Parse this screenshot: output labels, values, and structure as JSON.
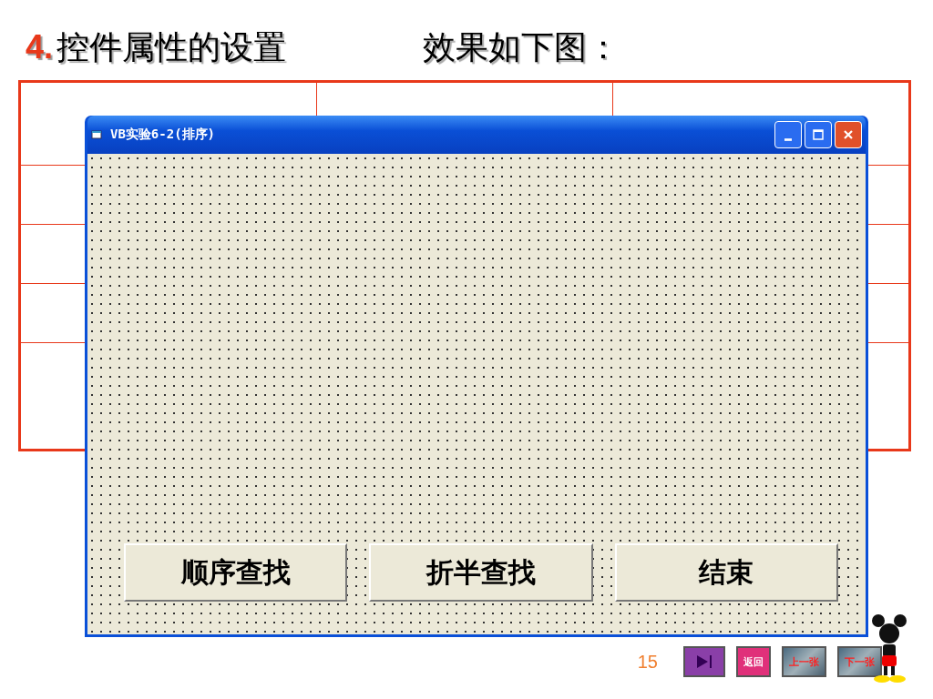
{
  "slide": {
    "heading_number": "4.",
    "heading": "控件属性的设置",
    "caption": "效果如下图：",
    "page_number": "15"
  },
  "window": {
    "title": "VB实验6-2(排序)",
    "buttons": [
      {
        "label": "顺序查找"
      },
      {
        "label": "折半查找"
      },
      {
        "label": "结束"
      }
    ]
  },
  "nav": [
    {
      "kind": "end"
    },
    {
      "kind": "pink",
      "label": "返回"
    },
    {
      "kind": "photo",
      "label": "上一张"
    },
    {
      "kind": "photo",
      "label": "下一张"
    }
  ]
}
